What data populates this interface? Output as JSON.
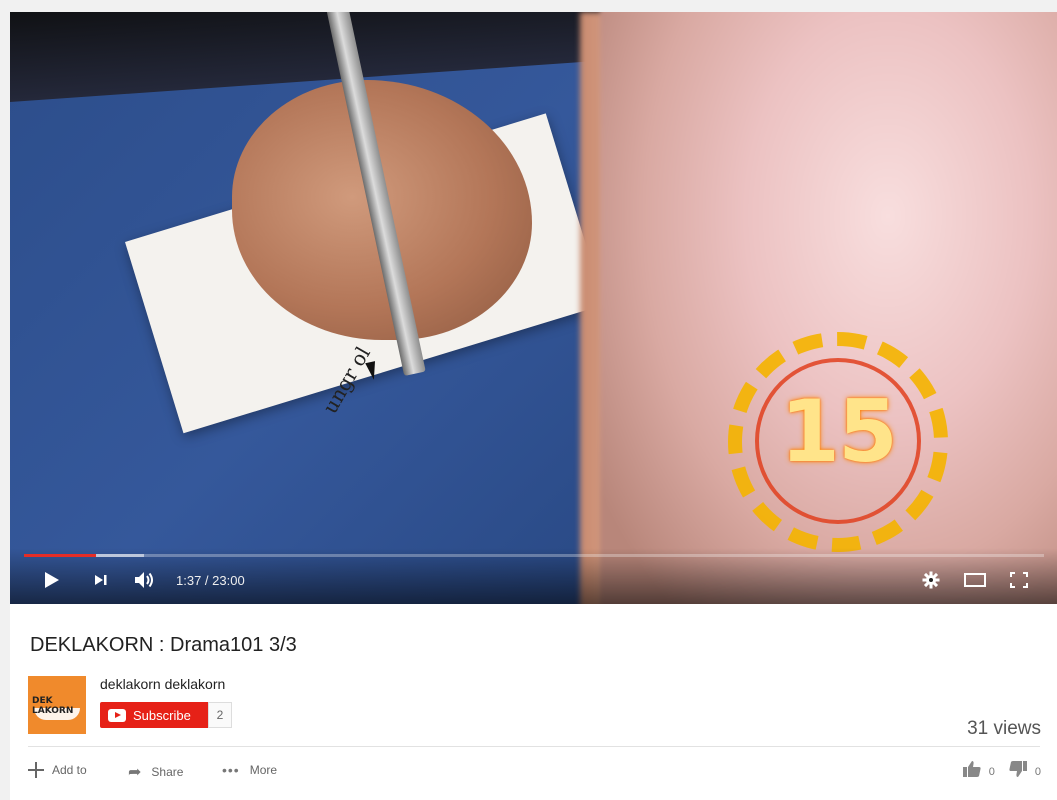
{
  "player": {
    "current_time": "1:37",
    "duration": "23:00",
    "time_separator": " / ",
    "played_fraction": 0.071,
    "loaded_fraction": 0.118,
    "overlay_countdown": "15",
    "card_scribble": "ungr ol",
    "icons": [
      "play-icon",
      "next-icon",
      "volume-icon",
      "gear-icon",
      "theater-icon",
      "fullscreen-icon"
    ]
  },
  "video": {
    "title": "DEKLAKORN : Drama101 3/3",
    "views": "31 views"
  },
  "channel": {
    "name": "deklakorn deklakorn",
    "avatar_text_line1": "DEK",
    "avatar_text_line2": "LAKORN",
    "subscribe_label": "Subscribe",
    "subscriber_count": "2"
  },
  "actions": {
    "add_to": "Add to",
    "share": "Share",
    "more": "More",
    "like_count": "0",
    "dislike_count": "0"
  },
  "colors": {
    "brand_red": "#e62117",
    "progress_red": "#e52d27",
    "countdown_yellow": "#ffe48a"
  }
}
